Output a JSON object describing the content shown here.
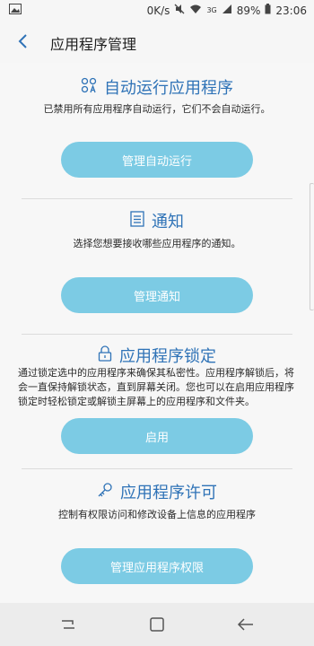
{
  "status": {
    "speed": "0K/s",
    "signal_label": "3G",
    "battery": "89%",
    "time": "23:06"
  },
  "header": {
    "title": "应用程序管理"
  },
  "sections": [
    {
      "title": "自动运行应用程序",
      "description": "已禁用所有应用程序自动运行，它们不会自动运行。",
      "button": "管理自动运行",
      "icon": "auto-run-icon"
    },
    {
      "title": "通知",
      "description": "选择您想要接收哪些应用程序的通知。",
      "button": "管理通知",
      "icon": "notification-icon"
    },
    {
      "title": "应用程序锁定",
      "description": "通过锁定选中的应用程序来确保其私密性。应用程序解锁后，将会一直保持解锁状态，直到屏幕关闭。您也可以在启用应用程序锁定时轻松锁定或解锁主屏幕上的应用程序和文件夹。",
      "button": "启用",
      "icon": "lock-icon"
    },
    {
      "title": "应用程序许可",
      "description": "控制有权限访问和修改设备上信息的应用程序",
      "button": "管理应用程序权限",
      "icon": "key-icon"
    }
  ],
  "colors": {
    "accent": "#2f73b7",
    "button": "#7ccbe4"
  }
}
